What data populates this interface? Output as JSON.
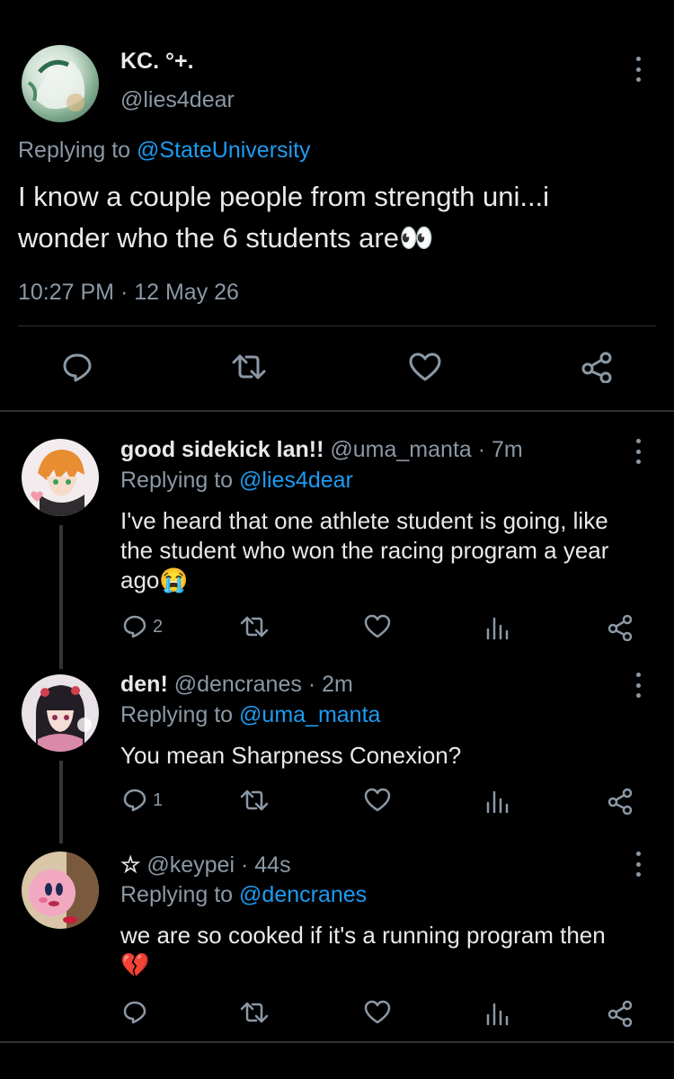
{
  "main_tweet": {
    "display_name": "KC. °+.",
    "handle": "@lies4dear",
    "replying_prefix": "Replying to",
    "replying_to": "@StateUniversity",
    "text_line1": "I know a couple people from strength uni...i",
    "text_line2": "wonder who the 6 students are",
    "emoji": "👀",
    "timestamp": "10:27 PM · 12 May 26"
  },
  "replies": [
    {
      "display_name": "good sidekick lan!!",
      "handle": "@uma_manta",
      "time": "· 7m",
      "replying_prefix": "Replying to",
      "replying_to": "@lies4dear",
      "text_line1": "I've heard that one athlete student is going, like",
      "text_line2": "the student who won the racing program a year",
      "text_line3": "ago",
      "emoji": "😭",
      "reply_count": "2"
    },
    {
      "display_name": "den!",
      "handle": "@dencranes",
      "time": "· 2m",
      "replying_prefix": "Replying to",
      "replying_to": "@uma_manta",
      "text_line1": "You mean Sharpness Conexion?",
      "reply_count": "1"
    },
    {
      "display_name": "☆",
      "handle": "@keypei",
      "time": "· 44s",
      "replying_prefix": "Replying to",
      "replying_to": "@dencranes",
      "text_line1": "we are so cooked if it's a running program then",
      "emoji": "💔",
      "reply_count": ""
    }
  ],
  "icons": [
    "reply-icon",
    "retweet-icon",
    "like-icon",
    "views-icon",
    "share-icon",
    "more-icon"
  ],
  "colors": {
    "background": "#000000",
    "text": "#e7e9ea",
    "muted": "#8b98a5",
    "link": "#1d9bf0"
  }
}
